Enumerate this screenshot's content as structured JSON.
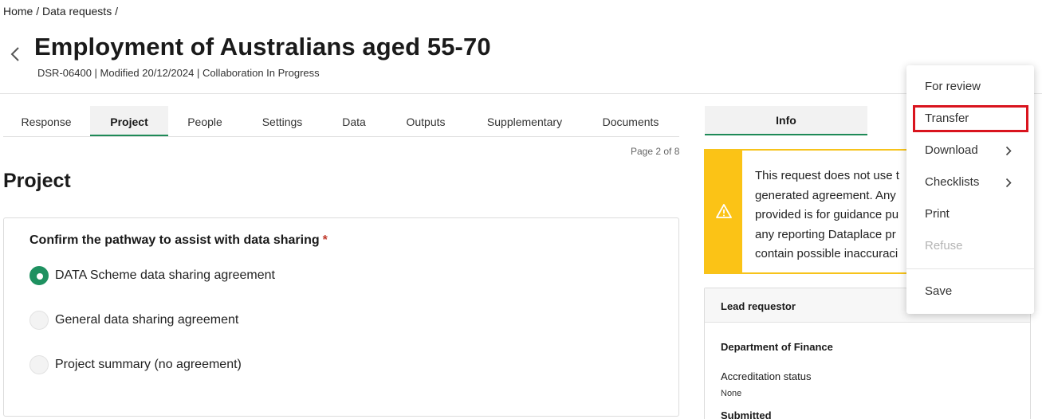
{
  "breadcrumb": {
    "home": "Home",
    "sep1": " / ",
    "data_requests": "Data requests",
    "sep2": " /"
  },
  "header": {
    "title": "Employment of Australians aged 55-70",
    "meta": "DSR-06400 | Modified 20/12/2024 | Collaboration In Progress"
  },
  "tabs": [
    "Response",
    "Project",
    "People",
    "Settings",
    "Data",
    "Outputs",
    "Supplementary",
    "Documents"
  ],
  "active_tab": "Project",
  "page_indicator": "Page 2 of 8",
  "section_title": "Project",
  "question": {
    "label": "Confirm the pathway to assist with data sharing",
    "required_mark": "*",
    "options": [
      {
        "label": "DATA Scheme data sharing agreement",
        "checked": true
      },
      {
        "label": "General data sharing agreement",
        "checked": false
      },
      {
        "label": "Project summary (no agreement)",
        "checked": false
      }
    ]
  },
  "side_panel": {
    "tab": "Info",
    "warning_lines": [
      "This request does not use t",
      "generated agreement. Any",
      "provided is for guidance pu",
      "any reporting Dataplace pr",
      "contain possible inaccuraci"
    ],
    "lead": {
      "heading": "Lead requestor",
      "organisation": "Department of Finance",
      "accreditation_label": "Accreditation status",
      "accreditation_value": "None",
      "submitted_label": "Submitted"
    }
  },
  "menu": {
    "for_review": "For review",
    "transfer": "Transfer",
    "download": "Download",
    "checklists": "Checklists",
    "print": "Print",
    "refuse": "Refuse",
    "save": "Save"
  },
  "colors": {
    "accent_green": "#1e9160",
    "warning_yellow": "#fbc316",
    "highlight_red": "#d9141e",
    "required_red": "#c0392b"
  }
}
